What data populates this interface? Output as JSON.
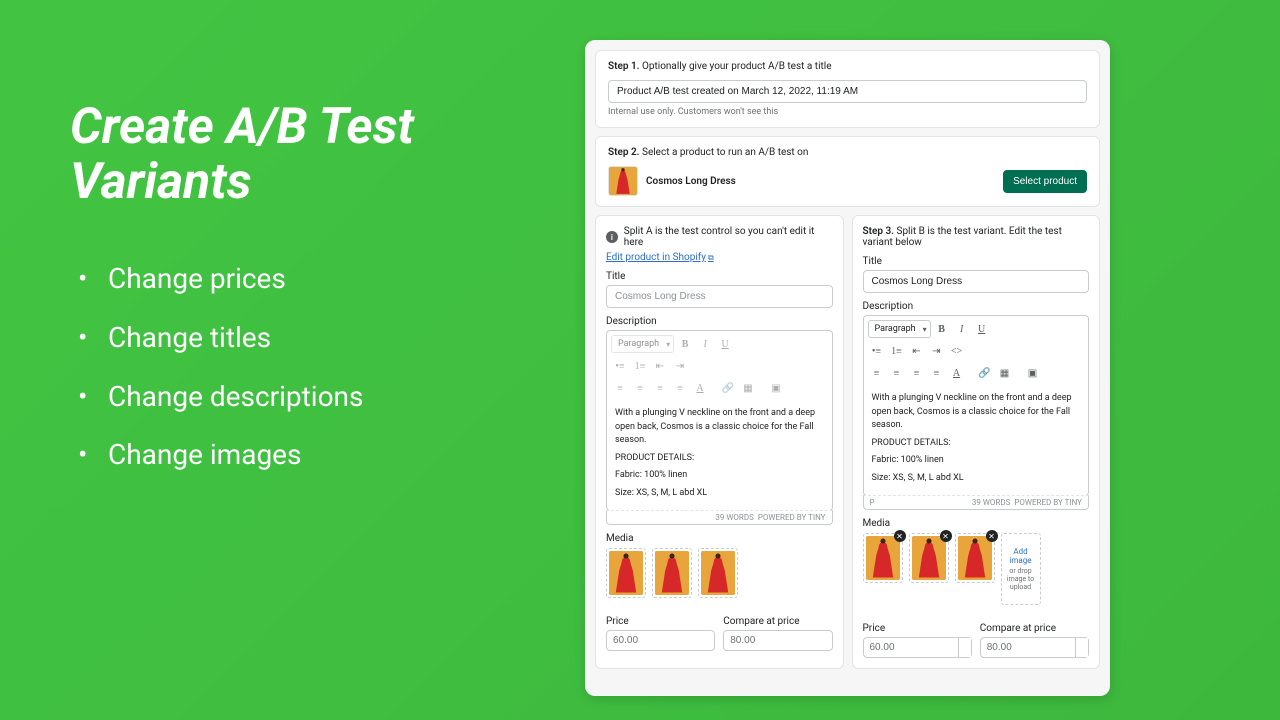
{
  "promo": {
    "heading": "Create A/B Test Variants",
    "bullets": [
      "Change prices",
      "Change titles",
      "Change descriptions",
      "Change images"
    ]
  },
  "step1": {
    "label": "Step 1.",
    "text": "Optionally give your product A/B test a title",
    "input_value": "Product A/B test created on March 12, 2022, 11:19 AM",
    "hint": "Internal use only. Customers won't see this"
  },
  "step2": {
    "label": "Step 2.",
    "text": "Select a product to run an A/B test on",
    "product_name": "Cosmos Long Dress",
    "button": "Select product"
  },
  "splitA": {
    "info": "Split A is the test control so you can't edit it here",
    "edit_link": "Edit product in Shopify",
    "title_label": "Title",
    "title_value": "Cosmos Long Dress",
    "desc_label": "Description",
    "paragraph_label": "Paragraph",
    "body_lines": [
      "With a plunging V neckline on the front and a deep open back, Cosmos is a classic choice for the Fall season.",
      "PRODUCT DETAILS:",
      "Fabric: 100% linen",
      "Size: XS, S, M, L abd XL"
    ],
    "word_count": "39 WORDS",
    "powered": "POWERED BY TINY",
    "media_label": "Media",
    "price_label": "Price",
    "price_value": "60.00",
    "compare_label": "Compare at price",
    "compare_value": "80.00"
  },
  "splitB": {
    "step_label": "Step 3.",
    "step_text": "Split B is the test variant. Edit the test variant below",
    "title_label": "Title",
    "title_value": "Cosmos Long Dress",
    "desc_label": "Description",
    "paragraph_label": "Paragraph",
    "body_lines": [
      "With a plunging V neckline on the front and a deep open back, Cosmos is a classic choice for the Fall season.",
      "PRODUCT DETAILS:",
      "Fabric: 100% linen",
      "Size: XS, S, M, L abd XL"
    ],
    "p_indicator": "P",
    "word_count": "39 WORDS",
    "powered": "POWERED BY TINY",
    "media_label": "Media",
    "add_image": "Add image",
    "add_image_hint": "or drop image to upload",
    "price_label": "Price",
    "price_value": "60.00",
    "compare_label": "Compare at price",
    "compare_value": "80.00"
  }
}
